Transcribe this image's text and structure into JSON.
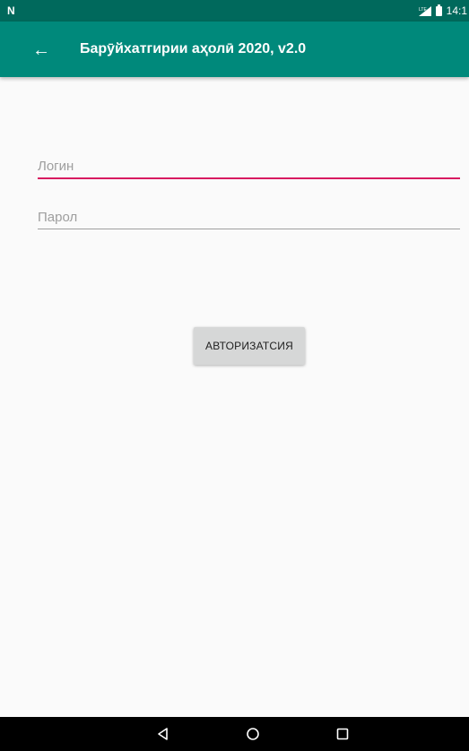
{
  "status_bar": {
    "left_icon": "N",
    "network_label": "LTE",
    "time": "14:1"
  },
  "app_bar": {
    "title": "Барӯйхатгирии аҳолӣ 2020, v2.0",
    "back_icon": "←"
  },
  "form": {
    "login": {
      "placeholder": "Логин",
      "value": ""
    },
    "password": {
      "placeholder": "Парол",
      "value": ""
    },
    "auth_button_label": "АВТОРИЗАТСИЯ"
  },
  "colors": {
    "status_bar": "#00695c",
    "app_bar": "#00897b",
    "accent": "#d81b60",
    "background": "#fafafa",
    "button": "#d6d7d7"
  },
  "icons": {
    "back": "arrow-back-icon",
    "signal": "lte-signal-icon",
    "battery": "battery-icon",
    "nav_back": "triangle-back-icon",
    "nav_home": "circle-home-icon",
    "nav_recents": "square-recents-icon"
  }
}
